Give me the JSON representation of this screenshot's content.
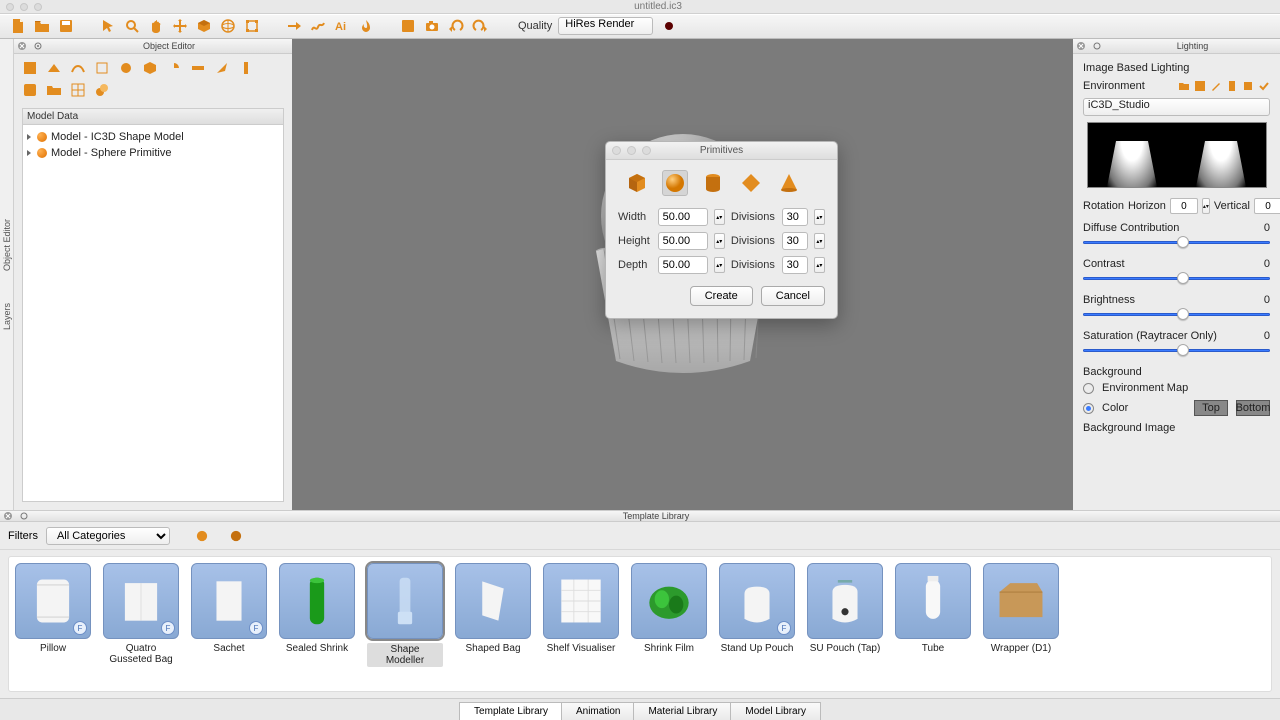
{
  "window": {
    "title": "untitled.ic3"
  },
  "toolbar": {
    "quality_label": "Quality",
    "quality_value": "HiRes Render"
  },
  "side_tabs": {
    "object_editor": "Object Editor",
    "layers": "Layers"
  },
  "left_panel": {
    "title": "Object Editor",
    "model_data_header": "Model Data",
    "tree": [
      {
        "label": "Model - IC3D Shape Model"
      },
      {
        "label": "Model - Sphere Primitive"
      }
    ]
  },
  "dialog": {
    "title": "Primitives",
    "width_label": "Width",
    "width_value": "50.00",
    "height_label": "Height",
    "height_value": "50.00",
    "depth_label": "Depth",
    "depth_value": "50.00",
    "divisions_label": "Divisions",
    "divisions1": "30",
    "divisions2": "30",
    "divisions3": "30",
    "create": "Create",
    "cancel": "Cancel"
  },
  "right_panel": {
    "title": "Lighting",
    "section": "Image Based Lighting",
    "env_label": "Environment",
    "env_value": "iC3D_Studio",
    "rot_label": "Rotation",
    "horizon_label": "Horizon",
    "horizon_val": "0",
    "vertical_label": "Vertical",
    "vertical_val": "0",
    "diffuse_label": "Diffuse Contribution",
    "diffuse_val": "0",
    "contrast_label": "Contrast",
    "contrast_val": "0",
    "brightness_label": "Brightness",
    "brightness_val": "0",
    "saturation_label": "Saturation (Raytracer Only)",
    "saturation_val": "0",
    "background_label": "Background",
    "envmap_label": "Environment Map",
    "color_label": "Color",
    "top_btn": "Top",
    "bottom_btn": "Bottom",
    "bgimage_label": "Background Image"
  },
  "bottom": {
    "title": "Template Library",
    "filters_label": "Filters",
    "filters_value": "All Categories",
    "tabs": {
      "template": "Template Library",
      "animation": "Animation",
      "material": "Material Library",
      "model": "Model Library"
    },
    "items": [
      {
        "label": "Pillow",
        "badge": "F"
      },
      {
        "label": "Quatro Gusseted Bag",
        "badge": "F"
      },
      {
        "label": "Sachet",
        "badge": "F"
      },
      {
        "label": "Sealed Shrink",
        "badge": ""
      },
      {
        "label": "Shape Modeller",
        "badge": ""
      },
      {
        "label": "Shaped Bag",
        "badge": ""
      },
      {
        "label": "Shelf Visualiser",
        "badge": ""
      },
      {
        "label": "Shrink Film",
        "badge": ""
      },
      {
        "label": "Stand Up Pouch",
        "badge": "F"
      },
      {
        "label": "SU Pouch (Tap)",
        "badge": ""
      },
      {
        "label": "Tube",
        "badge": ""
      },
      {
        "label": "Wrapper (D1)",
        "badge": ""
      }
    ]
  }
}
